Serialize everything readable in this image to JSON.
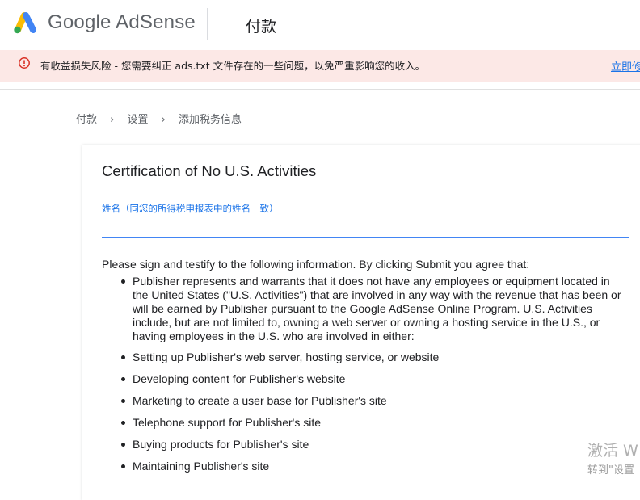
{
  "header": {
    "brand": "Google AdSense",
    "page_title": "付款"
  },
  "alert": {
    "icon": "error-circle-icon",
    "text": "有收益损失风险 - 您需要纠正 ads.txt 文件存在的一些问题，以免严重影响您的收入。",
    "action": "立即修"
  },
  "breadcrumb": [
    "付款",
    "设置",
    "添加税务信息"
  ],
  "card": {
    "title": "Certification of No U.S. Activities",
    "field_label": "姓名（同您的所得税申报表中的姓名一致）",
    "field_value": "",
    "intro": "Please sign and testify to the following information. By clicking Submit you agree that:",
    "items": [
      "Publisher represents and warrants that it does not have any employees or equipment located in the United States (\"U.S. Activities\") that are involved in any way with the revenue that has been or will be earned by Publisher pursuant to the Google AdSense Online Program. U.S. Activities include, but are not limited to, owning a web server or owning a hosting service in the U.S., or having employees in the U.S. who are involved in either:",
      "Setting up Publisher's web server, hosting service, or website",
      "Developing content for Publisher's website",
      "Marketing to create a user base for Publisher's site",
      "Telephone support for Publisher's site",
      "Buying products for Publisher's site",
      "Maintaining Publisher's site"
    ]
  },
  "watermark": {
    "line1": "激活 W",
    "line2": "转到\"设置"
  },
  "colors": {
    "logo_yellow": "#fbbc04",
    "logo_blue": "#4285f4",
    "logo_green": "#34a853",
    "alert_bg": "#fce8e6",
    "alert_red": "#d93025",
    "link_blue": "#1a73e8"
  }
}
